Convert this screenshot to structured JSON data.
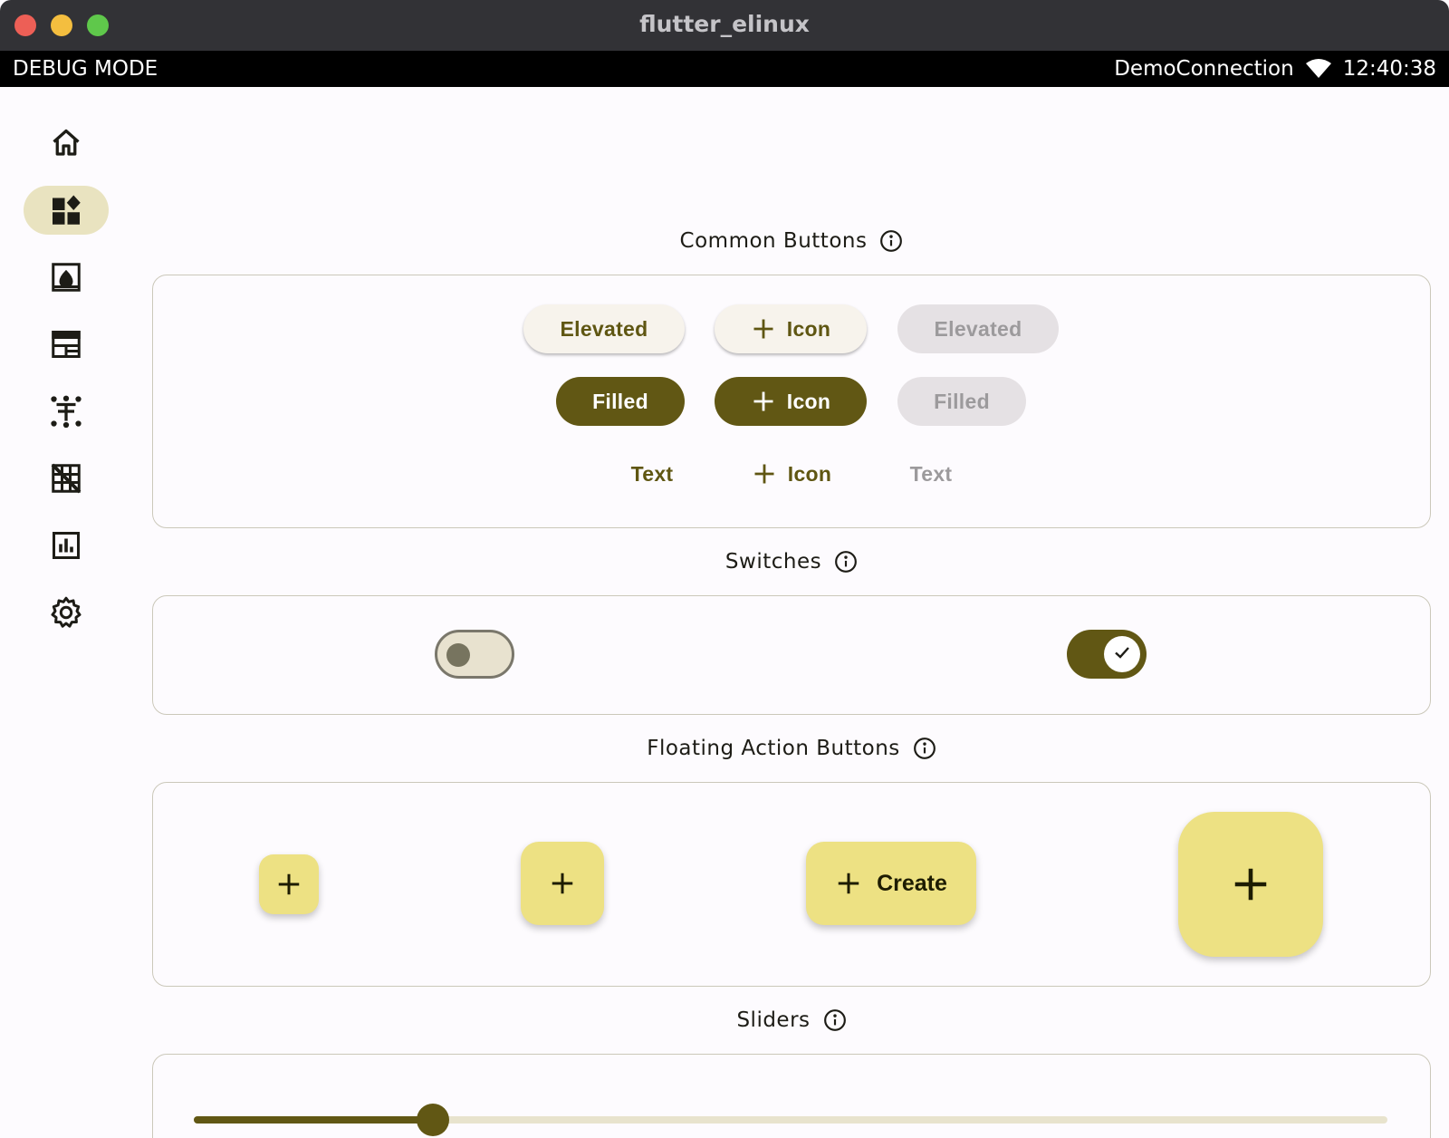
{
  "window": {
    "title": "flutter_elinux"
  },
  "statusbar": {
    "debug_label": "DEBUG MODE",
    "network": "DemoConnection",
    "time": "12:40:38"
  },
  "rail": {
    "items": [
      {
        "icon": "home-icon",
        "active": false
      },
      {
        "icon": "widgets-icon",
        "active": true
      },
      {
        "icon": "image-icon",
        "active": false
      },
      {
        "icon": "table-chart-icon",
        "active": false
      },
      {
        "icon": "text-icon",
        "active": false
      },
      {
        "icon": "grid-off-icon",
        "active": false
      },
      {
        "icon": "bar-chart-icon",
        "active": false
      },
      {
        "icon": "settings-icon",
        "active": false
      }
    ]
  },
  "sections": {
    "common_buttons": {
      "title": "Common Buttons",
      "elevated": "Elevated",
      "elevated_icon": "Icon",
      "elevated_disabled": "Elevated",
      "filled": "Filled",
      "filled_icon": "Icon",
      "filled_disabled": "Filled",
      "text": "Text",
      "text_icon": "Icon",
      "text_disabled": "Text"
    },
    "switches": {
      "title": "Switches",
      "switch1_on": false,
      "switch2_on": true
    },
    "fabs": {
      "title": "Floating Action Buttons",
      "extended_label": "Create"
    },
    "sliders": {
      "title": "Sliders",
      "value": 0.2
    }
  },
  "colors": {
    "primary": "#615714",
    "primary_container": "#ede183",
    "selected_nav": "#e9e3c0",
    "outline": "#cbc8ba"
  }
}
